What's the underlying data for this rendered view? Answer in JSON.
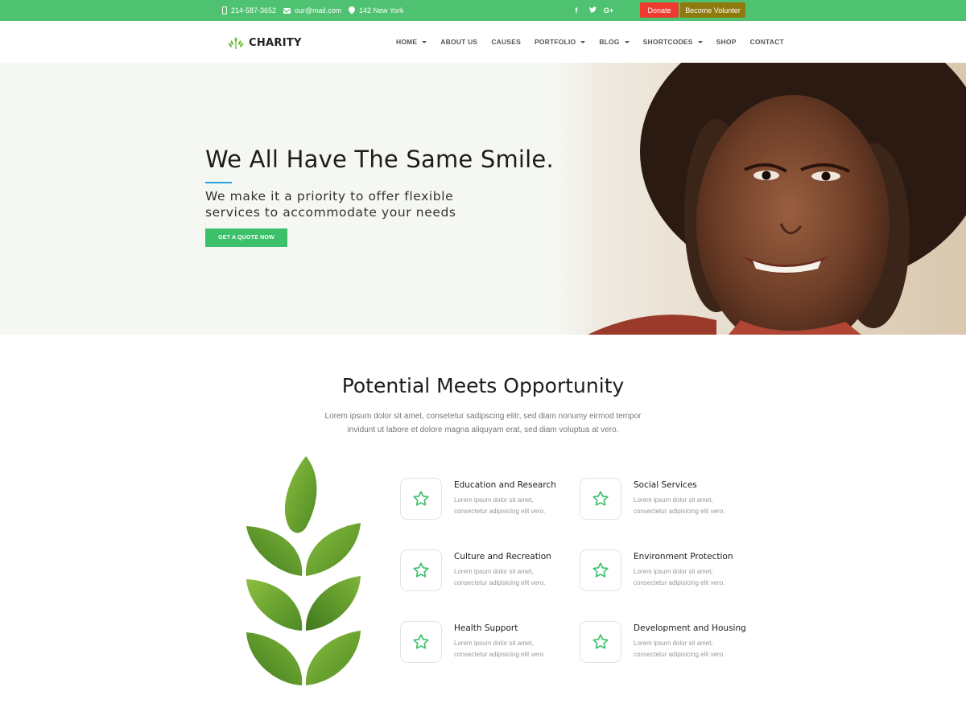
{
  "topbar": {
    "phone": "214-587-3652",
    "email": "our@mail.com",
    "location": "142 New York",
    "social": [
      "f",
      "t",
      "G+"
    ],
    "donate_label": "Donate",
    "volunteer_label": "Become Volunter",
    "colors": {
      "bar": "#4ec270",
      "donate": "#ed3b30",
      "volunteer": "#8f7a0e"
    }
  },
  "nav": {
    "logo_text": "CHARITY",
    "items": [
      {
        "label": "HOME",
        "dropdown": true
      },
      {
        "label": "ABOUT US",
        "dropdown": false
      },
      {
        "label": "CAUSES",
        "dropdown": false
      },
      {
        "label": "PORTFOLIO",
        "dropdown": true
      },
      {
        "label": "BLOG",
        "dropdown": true
      },
      {
        "label": "SHORTCODES",
        "dropdown": true
      },
      {
        "label": "SHOP",
        "dropdown": false
      },
      {
        "label": "CONTACT",
        "dropdown": false
      }
    ]
  },
  "hero": {
    "title": "We All Have The Same Smile.",
    "subtitle_line1": "We make it a priority to offer flexible",
    "subtitle_line2": "services to accommodate your needs",
    "cta_label": "GET A QUOTE NOW"
  },
  "section": {
    "title": "Potential Meets Opportunity",
    "description": "Lorem ipsum dolor sit amet, consetetur sadipscing elitr, sed diam nonumy eirmod tempor invidunt ut labore et dolore magna aliquyam erat, sed diam voluptua at vero."
  },
  "features": [
    {
      "icon": "star-icon",
      "title": "Education and Research",
      "text": "Lorem ipsum dolor sit amet, consectetur adipisicing elit vero."
    },
    {
      "icon": "star-icon",
      "title": "Social Services",
      "text": "Lorem ipsum dolor sit amet, consectetur adipisicing elit vero."
    },
    {
      "icon": "star-icon",
      "title": "Culture and Recreation",
      "text": "Lorem ipsum dolor sit amet, consectetur adipisicing elit vero."
    },
    {
      "icon": "star-icon",
      "title": "Environment Protection",
      "text": "Lorem ipsum dolor sit amet, consectetur adipisicing elit vero."
    },
    {
      "icon": "star-icon",
      "title": "Health Support",
      "text": "Lorem ipsum dolor sit amet, consectetur adipisicing elit vero."
    },
    {
      "icon": "star-icon",
      "title": "Development and Housing",
      "text": "Lorem ipsum dolor sit amet, consectetur adipisicing elit vero."
    }
  ],
  "accent_color": "#3cc06a"
}
